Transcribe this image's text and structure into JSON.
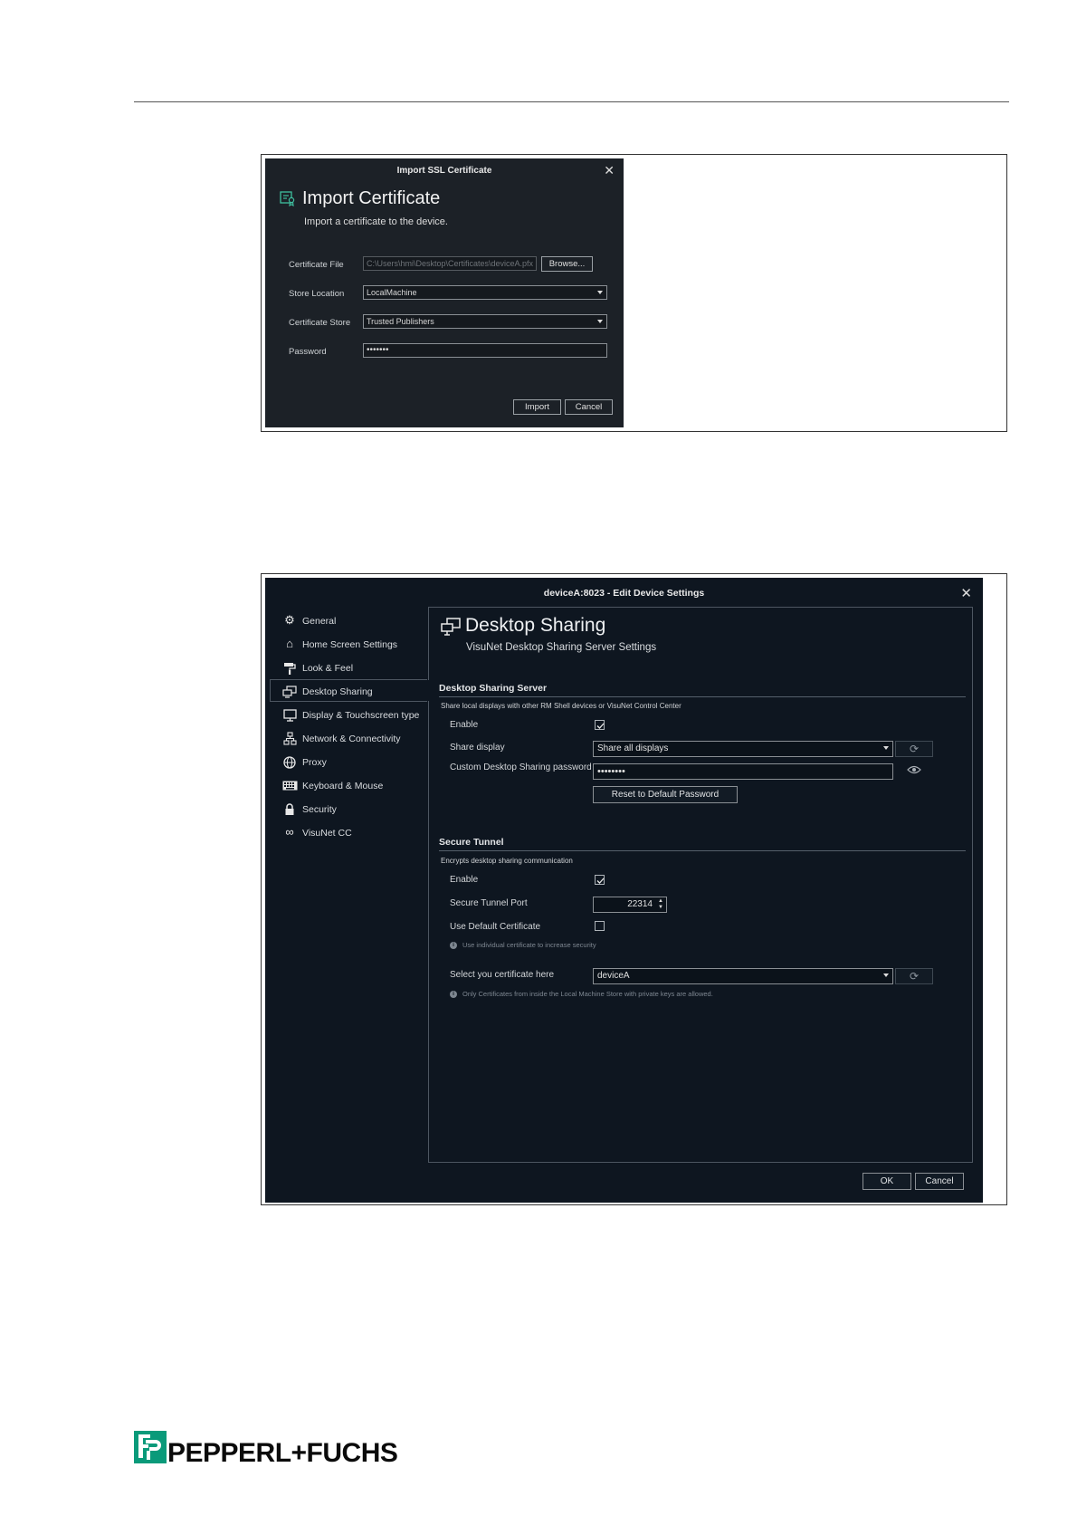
{
  "figure1": {
    "title": "Import SSL Certificate",
    "close_glyph": "✕",
    "heading": "Import Certificate",
    "subtitle": "Import a certificate to the device.",
    "fields": {
      "cert_file_label": "Certificate File",
      "cert_file_value": "C:\\Users\\hmi\\Desktop\\Certificates\\deviceA.pfx",
      "browse_label": "Browse...",
      "store_location_label": "Store Location",
      "store_location_value": "LocalMachine",
      "cert_store_label": "Certificate Store",
      "cert_store_value": "Trusted Publishers",
      "password_label": "Password",
      "password_value": "•••••••"
    },
    "import_label": "Import",
    "cancel_label": "Cancel",
    "accent_color": "#3fbf9f"
  },
  "figure2": {
    "title": "deviceA:8023 - Edit Device Settings",
    "close_glyph": "✕",
    "sidebar": [
      {
        "label": "General",
        "icon": "gear-icon"
      },
      {
        "label": "Home Screen Settings",
        "icon": "home-icon"
      },
      {
        "label": "Look & Feel",
        "icon": "paint-roller-icon"
      },
      {
        "label": "Desktop Sharing",
        "icon": "desktop-sharing-icon",
        "selected": true
      },
      {
        "label": "Display & Touchscreen type",
        "icon": "monitor-icon"
      },
      {
        "label": "Network & Connectivity",
        "icon": "network-icon"
      },
      {
        "label": "Proxy",
        "icon": "globe-icon"
      },
      {
        "label": "Keyboard & Mouse",
        "icon": "keyboard-icon"
      },
      {
        "label": "Security",
        "icon": "lock-icon"
      },
      {
        "label": "VisuNet CC",
        "icon": "infinity-icon"
      }
    ],
    "panel": {
      "title": "Desktop Sharing",
      "subtitle": "VisuNet Desktop Sharing Server Settings",
      "server": {
        "title": "Desktop Sharing Server",
        "description": "Share local displays with other RM Shell devices or VisuNet Control Center",
        "enable_label": "Enable",
        "enable_checked": true,
        "share_display_label": "Share display",
        "share_display_value": "Share all displays",
        "password_label": "Custom Desktop Sharing password",
        "password_value": "••••••••",
        "reset_label": "Reset to Default Password"
      },
      "tunnel": {
        "title": "Secure Tunnel",
        "description": "Encrypts desktop sharing communication",
        "enable_label": "Enable",
        "enable_checked": true,
        "port_label": "Secure Tunnel Port",
        "port_value": "22314",
        "default_cert_label": "Use Default Certificate",
        "default_cert_checked": false,
        "info1": "Use individual certificate to increase security",
        "select_cert_label": "Select you certificate here",
        "select_cert_value": "deviceA",
        "info2": "Only Certificates from inside the Local Machine Store with private keys are allowed."
      }
    },
    "ok_label": "OK",
    "cancel_label": "Cancel"
  },
  "logo": {
    "text": "PEPPERL+FUCHS",
    "brand_color": "#0a9a7a"
  }
}
